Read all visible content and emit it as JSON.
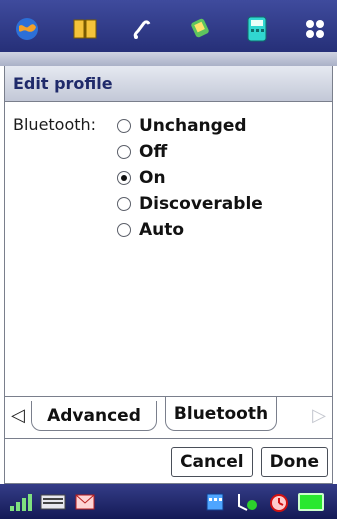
{
  "appbar": {
    "icons": [
      "globe-icon",
      "book-icon",
      "phone-icon",
      "messaging-icon",
      "calculator-icon",
      "apps-grid-icon"
    ]
  },
  "dialog": {
    "title": "Edit profile",
    "field_label": "Bluetooth:",
    "options": [
      {
        "label": "Unchanged",
        "checked": false
      },
      {
        "label": "Off",
        "checked": false
      },
      {
        "label": "On",
        "checked": true
      },
      {
        "label": "Discoverable",
        "checked": false
      },
      {
        "label": "Auto",
        "checked": false
      }
    ],
    "tabs": [
      "Advanced",
      "Bluetooth"
    ],
    "selected_tab": "Bluetooth",
    "buttons": {
      "cancel": "Cancel",
      "done": "Done"
    }
  },
  "statusbar": {
    "icons": [
      "signal-icon",
      "keyboard-icon",
      "mail-icon",
      "calendar-icon",
      "connection-icon",
      "alarm-icon",
      "battery-icon"
    ],
    "colors": {
      "battery": "#29e82f"
    }
  }
}
